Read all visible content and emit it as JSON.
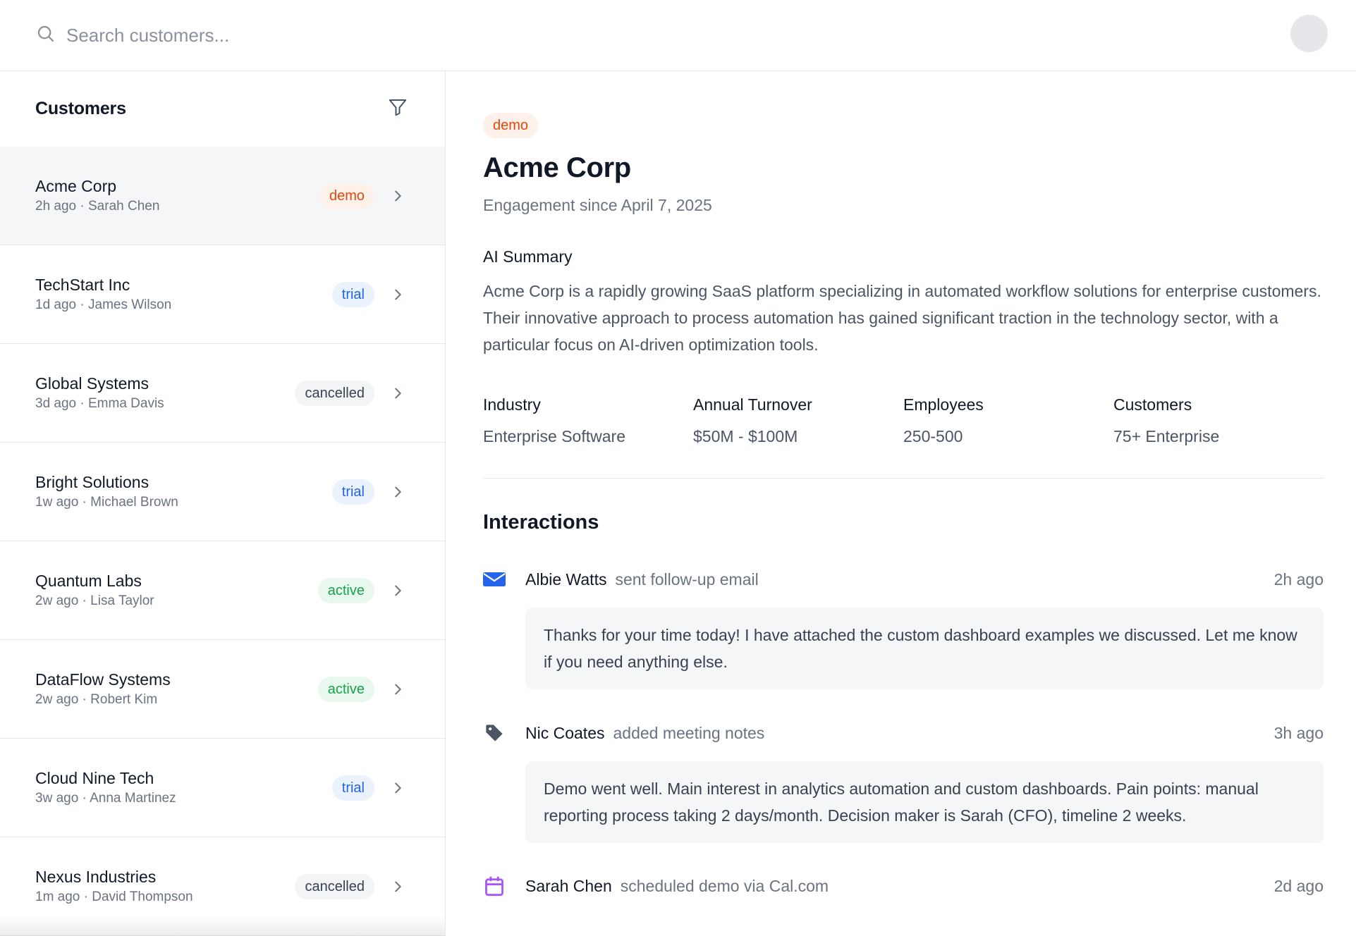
{
  "search": {
    "placeholder": "Search customers..."
  },
  "sidebar": {
    "title": "Customers",
    "customers": [
      {
        "name": "Acme Corp",
        "meta": "2h ago · Sarah Chen",
        "status": "demo"
      },
      {
        "name": "TechStart Inc",
        "meta": "1d ago · James Wilson",
        "status": "trial"
      },
      {
        "name": "Global Systems",
        "meta": "3d ago · Emma Davis",
        "status": "cancelled"
      },
      {
        "name": "Bright Solutions",
        "meta": "1w ago · Michael Brown",
        "status": "trial"
      },
      {
        "name": "Quantum Labs",
        "meta": "2w ago · Lisa Taylor",
        "status": "active"
      },
      {
        "name": "DataFlow Systems",
        "meta": "2w ago · Robert Kim",
        "status": "active"
      },
      {
        "name": "Cloud Nine Tech",
        "meta": "3w ago · Anna Martinez",
        "status": "trial"
      },
      {
        "name": "Nexus Industries",
        "meta": "1m ago · David Thompson",
        "status": "cancelled"
      }
    ]
  },
  "detail": {
    "status": "demo",
    "title": "Acme Corp",
    "subtitle": "Engagement since April 7, 2025",
    "ai_label": "AI Summary",
    "ai_summary": "Acme Corp is a rapidly growing SaaS platform specializing in automated workflow solutions for enterprise customers. Their innovative approach to process automation has gained significant traction in the technology sector, with a particular focus on AI-driven optimization tools.",
    "stats": [
      {
        "label": "Industry",
        "value": "Enterprise Software"
      },
      {
        "label": "Annual Turnover",
        "value": "$50M - $100M"
      },
      {
        "label": "Employees",
        "value": "250-500"
      },
      {
        "label": "Customers",
        "value": "75+ Enterprise"
      }
    ],
    "interactions_title": "Interactions",
    "interactions": [
      {
        "icon": "envelope-icon",
        "who": "Albie Watts",
        "action": "sent follow-up email",
        "time": "2h ago",
        "body": "Thanks for your time today! I have attached the custom dashboard examples we discussed. Let me know if you need anything else."
      },
      {
        "icon": "tag-icon",
        "who": "Nic Coates",
        "action": "added meeting notes",
        "time": "3h ago",
        "body": "Demo went well. Main interest in analytics automation and custom dashboards. Pain points: manual reporting process taking 2 days/month. Decision maker is Sarah (CFO), timeline 2 weeks."
      },
      {
        "icon": "calendar-icon",
        "who": "Sarah Chen",
        "action": "scheduled demo via Cal.com",
        "time": "2d ago",
        "body": ""
      }
    ]
  },
  "colors": {
    "email_icon": "#2563eb",
    "tag_icon": "#4b5563",
    "calendar_icon": "#a855f7"
  }
}
